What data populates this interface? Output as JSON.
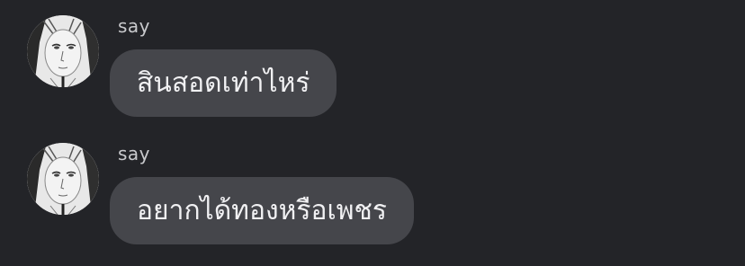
{
  "colors": {
    "background": "#232428",
    "bubble": "#45464b",
    "sender_text": "#c9cacd",
    "message_text": "#f1f1f3"
  },
  "messages": [
    {
      "avatar_icon": "user-avatar-icon",
      "sender": "say",
      "text": "สินสอดเท่าไหร่"
    },
    {
      "avatar_icon": "user-avatar-icon",
      "sender": "say",
      "text": "อยากได้ทองหรือเพชร"
    }
  ]
}
